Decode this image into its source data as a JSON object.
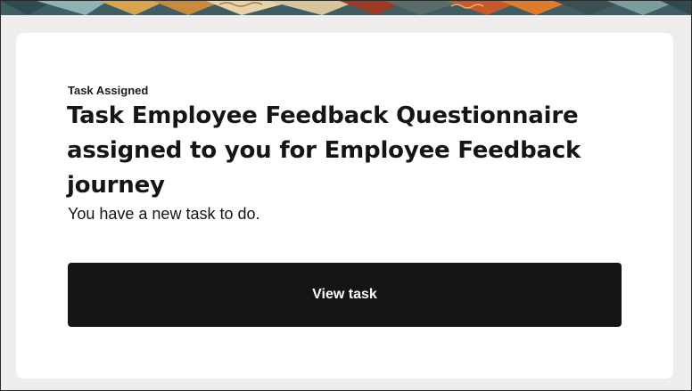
{
  "notification": {
    "eyebrow": "Task Assigned",
    "title": "Task Employee Feedback Questionnaire assigned to you for Employee Feedback journey",
    "message": "You have a new task to do.",
    "action_label": "View task"
  },
  "colors": {
    "page_background": "#efedeb",
    "card_background": "#ffffff",
    "text": "#161513",
    "button_background": "#161513",
    "button_text": "#ffffff"
  }
}
